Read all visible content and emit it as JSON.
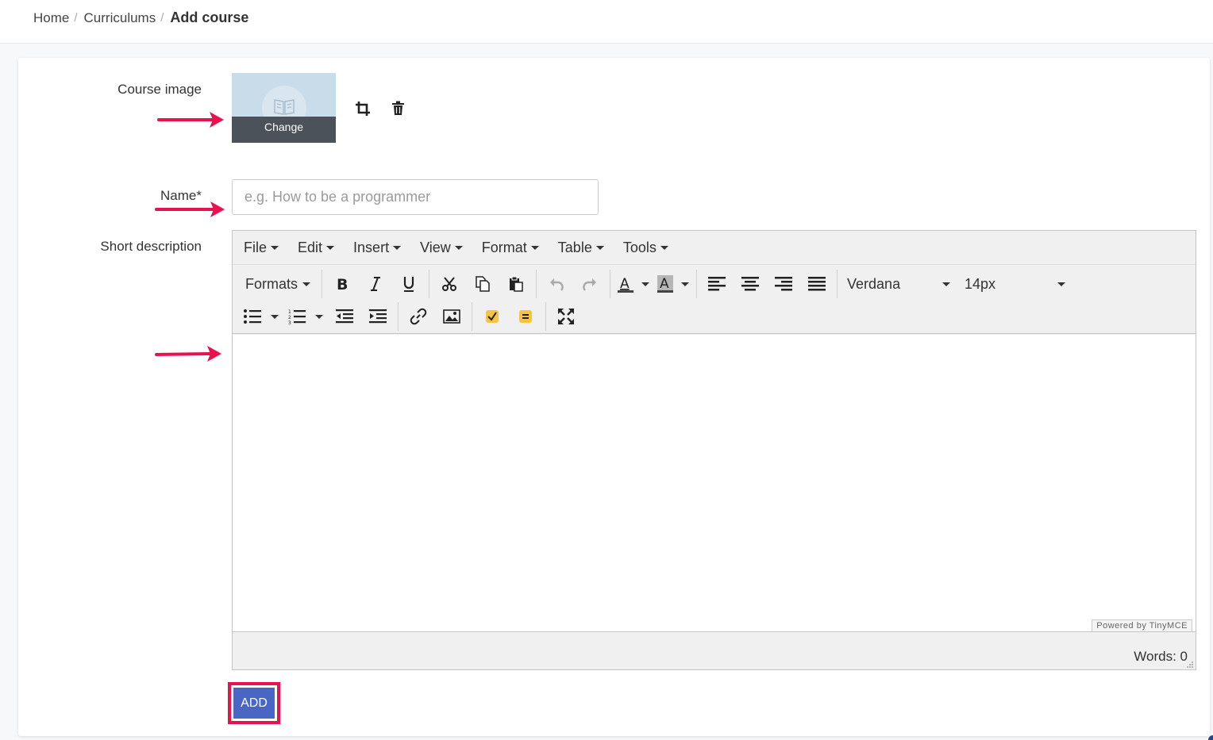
{
  "breadcrumb": {
    "home": "Home",
    "curriculums": "Curriculums",
    "current": "Add course",
    "separator": "/"
  },
  "form": {
    "course_image_label": "Course image",
    "change_label": "Change",
    "name_label": "Name*",
    "name_placeholder": "e.g. How to be a programmer",
    "short_description_label": "Short description"
  },
  "editor": {
    "menu": [
      "File",
      "Edit",
      "Insert",
      "View",
      "Format",
      "Table",
      "Tools"
    ],
    "formats_label": "Formats",
    "font_family": "Verdana",
    "font_size": "14px",
    "powered_by": "Powered by TinyMCE",
    "word_count": "Words: 0"
  },
  "actions": {
    "add_label": "ADD"
  },
  "colors": {
    "accent": "#4a66c4",
    "highlight": "#e8134e",
    "image_bg": "#c9dcea",
    "change_overlay": "#4b5259"
  },
  "icons": [
    "crop-icon",
    "trash-icon",
    "book-icon",
    "arrow-icon"
  ]
}
